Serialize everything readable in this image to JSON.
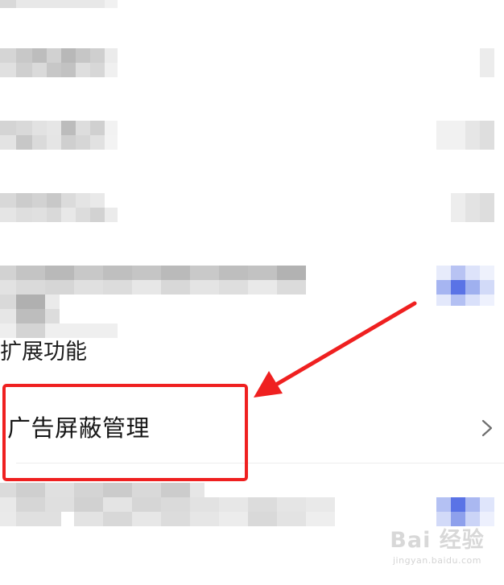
{
  "list": {
    "ad_block_item": {
      "label": "广告屏蔽管理",
      "chevron_icon": "chevron-right-icon"
    },
    "extension_item": {
      "label": "扩展功能"
    }
  },
  "annotation": {
    "box_color": "#ef2020",
    "arrow_color": "#ef2020"
  },
  "watermark": {
    "main": "Bai 经验",
    "sub": "jingyan.baidu.com"
  }
}
